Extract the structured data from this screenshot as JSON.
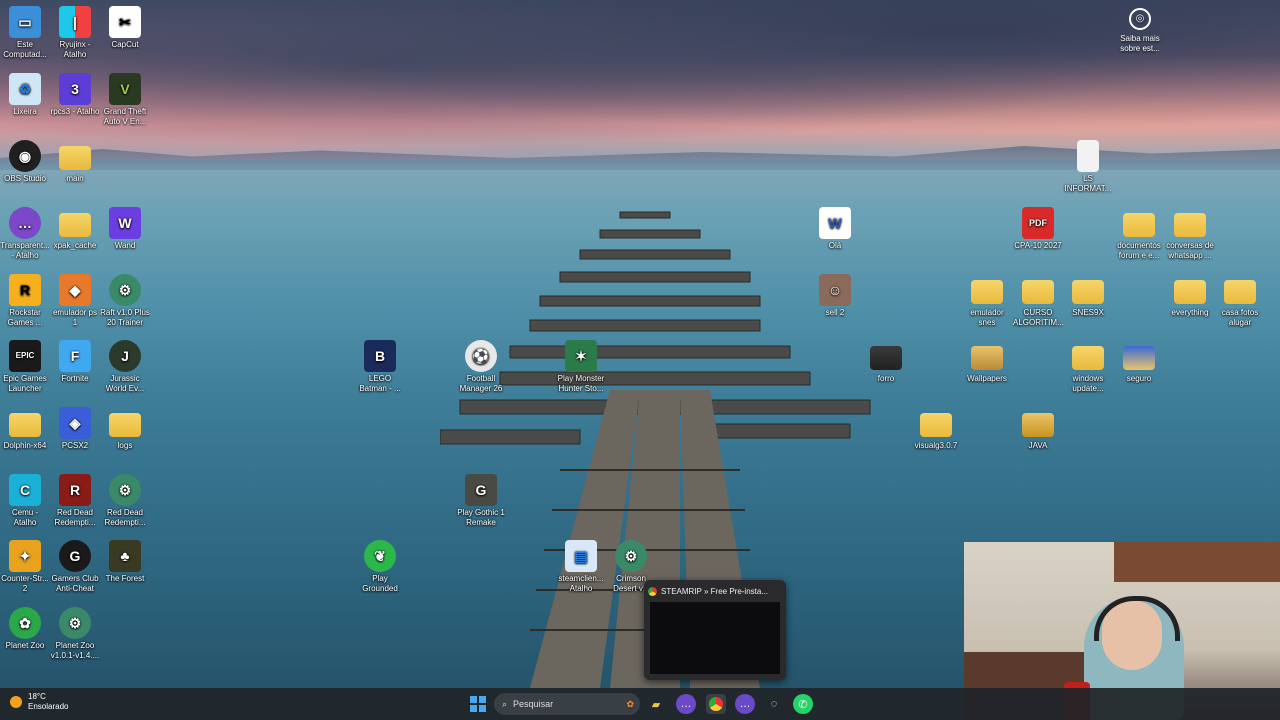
{
  "desktop_icons": [
    {
      "label": "Este Computad...",
      "icon": "computer-icon"
    },
    {
      "label": "Ryujinx - Atalho",
      "icon": "ryujinx-icon"
    },
    {
      "label": "CapCut",
      "icon": "capcut-icon"
    },
    {
      "label": "Lixeira",
      "icon": "recycle-bin-icon"
    },
    {
      "label": "rpcs3 - Atalho",
      "icon": "rpcs3-icon"
    },
    {
      "label": "Grand Theft Auto V En...",
      "icon": "gta-icon"
    },
    {
      "label": "OBS Studio",
      "icon": "obs-icon"
    },
    {
      "label": "main",
      "icon": "folder-icon"
    },
    {
      "label": "Transparent... - Atalho",
      "icon": "chat-icon"
    },
    {
      "label": "xpak_cache",
      "icon": "folder-icon"
    },
    {
      "label": "Wand",
      "icon": "wand-icon"
    },
    {
      "label": "Rockstar Games ...",
      "icon": "rockstar-icon"
    },
    {
      "label": "emulador ps 1",
      "icon": "emulator-icon"
    },
    {
      "label": "Raft v1.0 Plus 20 Trainer",
      "icon": "trainer-icon"
    },
    {
      "label": "Epic Games Launcher",
      "icon": "epic-icon"
    },
    {
      "label": "Fortnite",
      "icon": "fortnite-icon"
    },
    {
      "label": "Jurassic World Ev...",
      "icon": "jurassic-icon"
    },
    {
      "label": "Dolphin-x64",
      "icon": "folder-icon"
    },
    {
      "label": "PCSX2",
      "icon": "pcsx2-icon"
    },
    {
      "label": "logs",
      "icon": "folder-icon"
    },
    {
      "label": "Cemu - Atalho",
      "icon": "cemu-icon"
    },
    {
      "label": "Red Dead Redempti...",
      "icon": "rdr-icon"
    },
    {
      "label": "Red Dead Redempti...",
      "icon": "trainer-icon"
    },
    {
      "label": "Counter-Str... 2",
      "icon": "cs2-icon"
    },
    {
      "label": "Gamers Club Anti-Cheat",
      "icon": "gamersclub-icon"
    },
    {
      "label": "The Forest",
      "icon": "forest-icon"
    },
    {
      "label": "Planet Zoo",
      "icon": "planetzoo-icon"
    },
    {
      "label": "Planet Zoo v1.0.1-v1.4....",
      "icon": "trainer-icon"
    },
    {
      "label": "LEGO Batman - ...",
      "icon": "lego-icon"
    },
    {
      "label": "Football Manager 26",
      "icon": "fm-icon"
    },
    {
      "label": "Play Monster Hunter Sto...",
      "icon": "monster-icon"
    },
    {
      "label": "Play Gothic 1 Remake",
      "icon": "gothic-icon"
    },
    {
      "label": "Play Grounded",
      "icon": "grounded-icon"
    },
    {
      "label": "steamclien... Atalho",
      "icon": "steam-icon"
    },
    {
      "label": "Crimson Desert v...",
      "icon": "trainer-icon"
    },
    {
      "label": "Olá",
      "icon": "word-icon"
    },
    {
      "label": "sell 2",
      "icon": "photo-icon"
    },
    {
      "label": "forro",
      "icon": "folder-dark-icon"
    },
    {
      "label": "CPA-10 2027",
      "icon": "pdf-icon"
    },
    {
      "label": "documentos forum e e...",
      "icon": "folder-icon"
    },
    {
      "label": "conversas de whatsapp ...",
      "icon": "folder-icon"
    },
    {
      "label": "LS INFORMAT...",
      "icon": "file-icon"
    },
    {
      "label": "emulador snes",
      "icon": "folder-icon"
    },
    {
      "label": "CURSO ALGORITIM...",
      "icon": "folder-icon"
    },
    {
      "label": "SNES9X",
      "icon": "folder-icon"
    },
    {
      "label": "everything",
      "icon": "folder-icon"
    },
    {
      "label": "casa fotos alugar",
      "icon": "folder-icon"
    },
    {
      "label": "Wallpapers",
      "icon": "folder-photo-icon"
    },
    {
      "label": "windows update...",
      "icon": "folder-icon"
    },
    {
      "label": "seguro",
      "icon": "folder-photo-icon"
    },
    {
      "label": "visualg3.0.7",
      "icon": "folder-icon"
    },
    {
      "label": "JAVA",
      "icon": "folder-icon"
    }
  ],
  "learn_more": {
    "label": "Saiba mais sobre est...",
    "icon": "camera-circle-icon"
  },
  "taskbar": {
    "weather_temp": "18°C",
    "weather_desc": "Ensolarado",
    "search_placeholder": "Pesquisar",
    "preview_title": "STEAMRIP » Free Pre-insta..."
  },
  "colors": {
    "accent": "#2b7bd6",
    "folder": "#f0c64f",
    "taskbar": "#20242a"
  }
}
